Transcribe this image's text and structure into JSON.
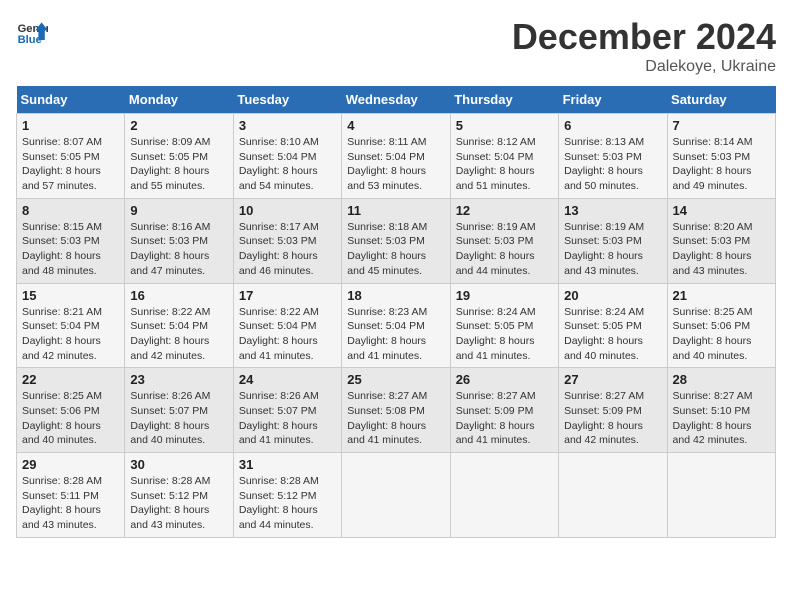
{
  "logo": {
    "line1": "General",
    "line2": "Blue"
  },
  "title": "December 2024",
  "subtitle": "Dalekoye, Ukraine",
  "days_header": [
    "Sunday",
    "Monday",
    "Tuesday",
    "Wednesday",
    "Thursday",
    "Friday",
    "Saturday"
  ],
  "weeks": [
    [
      {
        "num": "1",
        "detail": "Sunrise: 8:07 AM\nSunset: 5:05 PM\nDaylight: 8 hours\nand 57 minutes."
      },
      {
        "num": "2",
        "detail": "Sunrise: 8:09 AM\nSunset: 5:05 PM\nDaylight: 8 hours\nand 55 minutes."
      },
      {
        "num": "3",
        "detail": "Sunrise: 8:10 AM\nSunset: 5:04 PM\nDaylight: 8 hours\nand 54 minutes."
      },
      {
        "num": "4",
        "detail": "Sunrise: 8:11 AM\nSunset: 5:04 PM\nDaylight: 8 hours\nand 53 minutes."
      },
      {
        "num": "5",
        "detail": "Sunrise: 8:12 AM\nSunset: 5:04 PM\nDaylight: 8 hours\nand 51 minutes."
      },
      {
        "num": "6",
        "detail": "Sunrise: 8:13 AM\nSunset: 5:03 PM\nDaylight: 8 hours\nand 50 minutes."
      },
      {
        "num": "7",
        "detail": "Sunrise: 8:14 AM\nSunset: 5:03 PM\nDaylight: 8 hours\nand 49 minutes."
      }
    ],
    [
      {
        "num": "8",
        "detail": "Sunrise: 8:15 AM\nSunset: 5:03 PM\nDaylight: 8 hours\nand 48 minutes."
      },
      {
        "num": "9",
        "detail": "Sunrise: 8:16 AM\nSunset: 5:03 PM\nDaylight: 8 hours\nand 47 minutes."
      },
      {
        "num": "10",
        "detail": "Sunrise: 8:17 AM\nSunset: 5:03 PM\nDaylight: 8 hours\nand 46 minutes."
      },
      {
        "num": "11",
        "detail": "Sunrise: 8:18 AM\nSunset: 5:03 PM\nDaylight: 8 hours\nand 45 minutes."
      },
      {
        "num": "12",
        "detail": "Sunrise: 8:19 AM\nSunset: 5:03 PM\nDaylight: 8 hours\nand 44 minutes."
      },
      {
        "num": "13",
        "detail": "Sunrise: 8:19 AM\nSunset: 5:03 PM\nDaylight: 8 hours\nand 43 minutes."
      },
      {
        "num": "14",
        "detail": "Sunrise: 8:20 AM\nSunset: 5:03 PM\nDaylight: 8 hours\nand 43 minutes."
      }
    ],
    [
      {
        "num": "15",
        "detail": "Sunrise: 8:21 AM\nSunset: 5:04 PM\nDaylight: 8 hours\nand 42 minutes."
      },
      {
        "num": "16",
        "detail": "Sunrise: 8:22 AM\nSunset: 5:04 PM\nDaylight: 8 hours\nand 42 minutes."
      },
      {
        "num": "17",
        "detail": "Sunrise: 8:22 AM\nSunset: 5:04 PM\nDaylight: 8 hours\nand 41 minutes."
      },
      {
        "num": "18",
        "detail": "Sunrise: 8:23 AM\nSunset: 5:04 PM\nDaylight: 8 hours\nand 41 minutes."
      },
      {
        "num": "19",
        "detail": "Sunrise: 8:24 AM\nSunset: 5:05 PM\nDaylight: 8 hours\nand 41 minutes."
      },
      {
        "num": "20",
        "detail": "Sunrise: 8:24 AM\nSunset: 5:05 PM\nDaylight: 8 hours\nand 40 minutes."
      },
      {
        "num": "21",
        "detail": "Sunrise: 8:25 AM\nSunset: 5:06 PM\nDaylight: 8 hours\nand 40 minutes."
      }
    ],
    [
      {
        "num": "22",
        "detail": "Sunrise: 8:25 AM\nSunset: 5:06 PM\nDaylight: 8 hours\nand 40 minutes."
      },
      {
        "num": "23",
        "detail": "Sunrise: 8:26 AM\nSunset: 5:07 PM\nDaylight: 8 hours\nand 40 minutes."
      },
      {
        "num": "24",
        "detail": "Sunrise: 8:26 AM\nSunset: 5:07 PM\nDaylight: 8 hours\nand 41 minutes."
      },
      {
        "num": "25",
        "detail": "Sunrise: 8:27 AM\nSunset: 5:08 PM\nDaylight: 8 hours\nand 41 minutes."
      },
      {
        "num": "26",
        "detail": "Sunrise: 8:27 AM\nSunset: 5:09 PM\nDaylight: 8 hours\nand 41 minutes."
      },
      {
        "num": "27",
        "detail": "Sunrise: 8:27 AM\nSunset: 5:09 PM\nDaylight: 8 hours\nand 42 minutes."
      },
      {
        "num": "28",
        "detail": "Sunrise: 8:27 AM\nSunset: 5:10 PM\nDaylight: 8 hours\nand 42 minutes."
      }
    ],
    [
      {
        "num": "29",
        "detail": "Sunrise: 8:28 AM\nSunset: 5:11 PM\nDaylight: 8 hours\nand 43 minutes."
      },
      {
        "num": "30",
        "detail": "Sunrise: 8:28 AM\nSunset: 5:12 PM\nDaylight: 8 hours\nand 43 minutes."
      },
      {
        "num": "31",
        "detail": "Sunrise: 8:28 AM\nSunset: 5:12 PM\nDaylight: 8 hours\nand 44 minutes."
      },
      null,
      null,
      null,
      null
    ]
  ]
}
